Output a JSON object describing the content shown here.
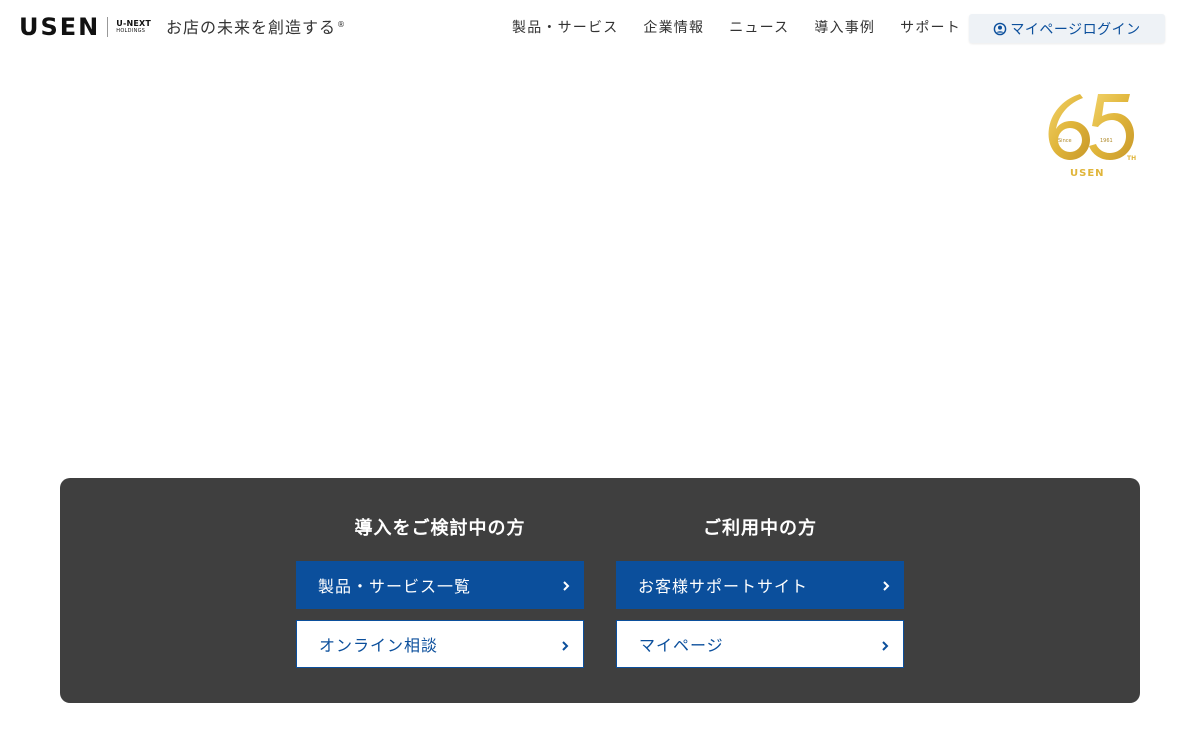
{
  "header": {
    "logo": {
      "brand": "USEN",
      "parent_line1": "U-NEXT",
      "parent_line2": "HOLDINGS"
    },
    "tagline": "お店の未来を創造する",
    "tagline_mark": "®",
    "nav": [
      {
        "label": "製品・サービス"
      },
      {
        "label": "企業情報"
      },
      {
        "label": "ニュース"
      },
      {
        "label": "導入事例"
      },
      {
        "label": "サポート"
      }
    ],
    "login": {
      "label": "マイページログイン",
      "icon": "user-circle-icon"
    }
  },
  "emblem": {
    "number": "65",
    "since": "Since",
    "year": "1961",
    "suffix": "TH",
    "brand": "USEN"
  },
  "cta_panel": {
    "left": {
      "title": "導入をご検討中の方",
      "primary": "製品・サービス一覧",
      "secondary": "オンライン相談"
    },
    "right": {
      "title": "ご利用中の方",
      "primary": "お客様サポートサイト",
      "secondary": "マイページ"
    }
  },
  "colors": {
    "brand_blue": "#0b4f9c",
    "panel_bg": "#3f3f3f",
    "gold": "#e2b93b",
    "login_bg": "#eef2f6"
  }
}
